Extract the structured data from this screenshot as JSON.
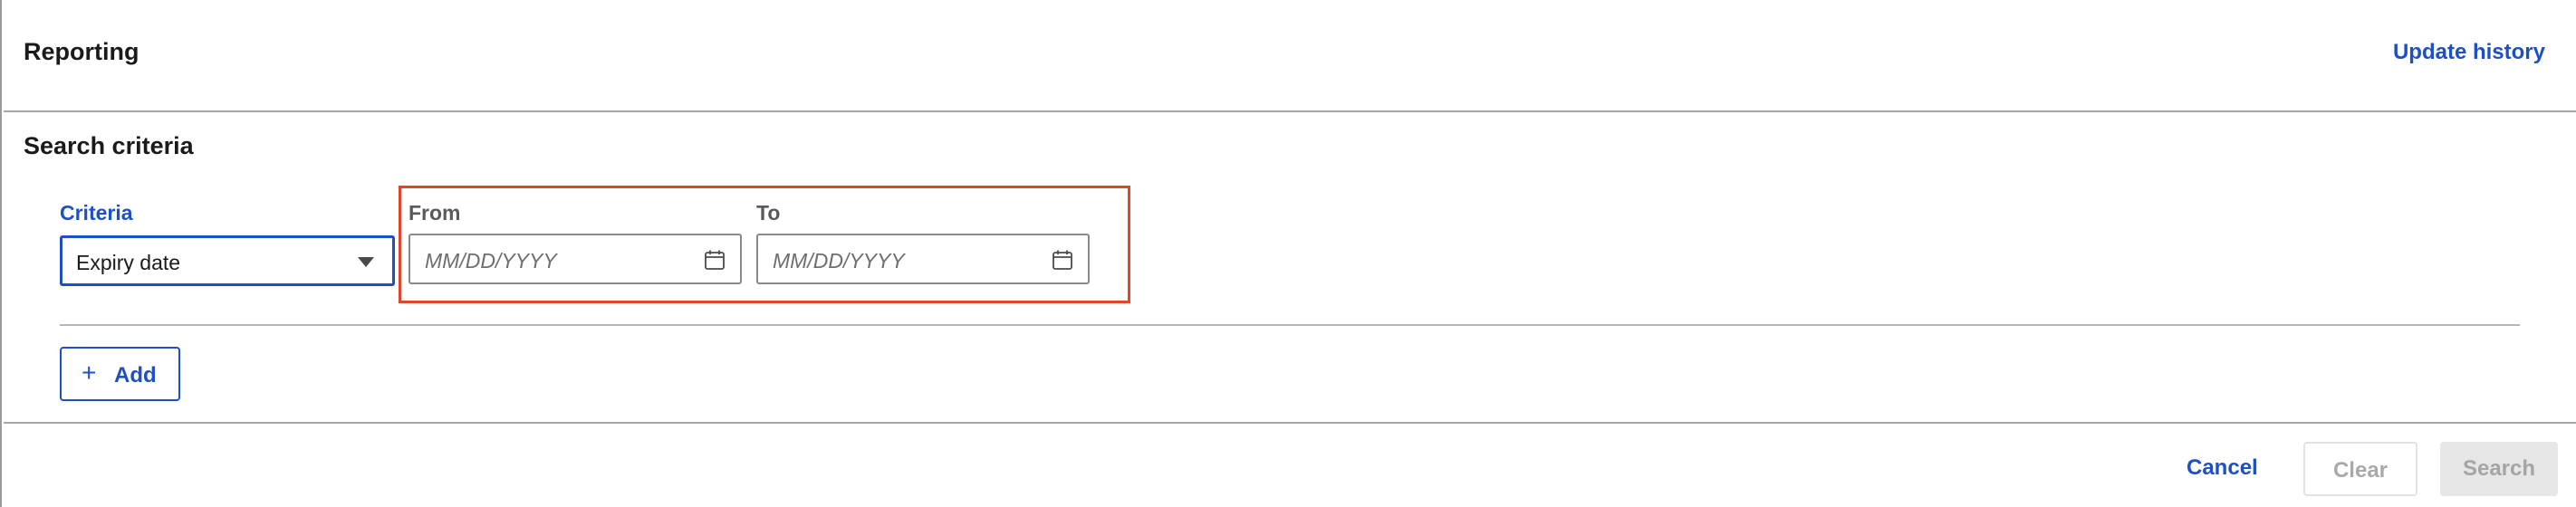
{
  "header": {
    "title": "Reporting",
    "update_history_link": "Update history"
  },
  "search": {
    "section_title": "Search criteria",
    "criteria_label": "Criteria",
    "criteria_selected": "Expiry date",
    "from_label": "From",
    "from_placeholder": "MM/DD/YYYY",
    "to_label": "To",
    "to_placeholder": "MM/DD/YYYY",
    "add_label": "Add"
  },
  "footer": {
    "cancel_label": "Cancel",
    "clear_label": "Clear",
    "search_label": "Search"
  },
  "icons": {
    "caret": "chevron-down-icon",
    "calendar": "calendar-icon",
    "add": "plus-icon"
  },
  "colors": {
    "accent": "#1f4fc6",
    "highlight_border": "#e0452e",
    "disabled_text": "#a9a9a9",
    "disabled_bg": "#e6e6e6"
  }
}
